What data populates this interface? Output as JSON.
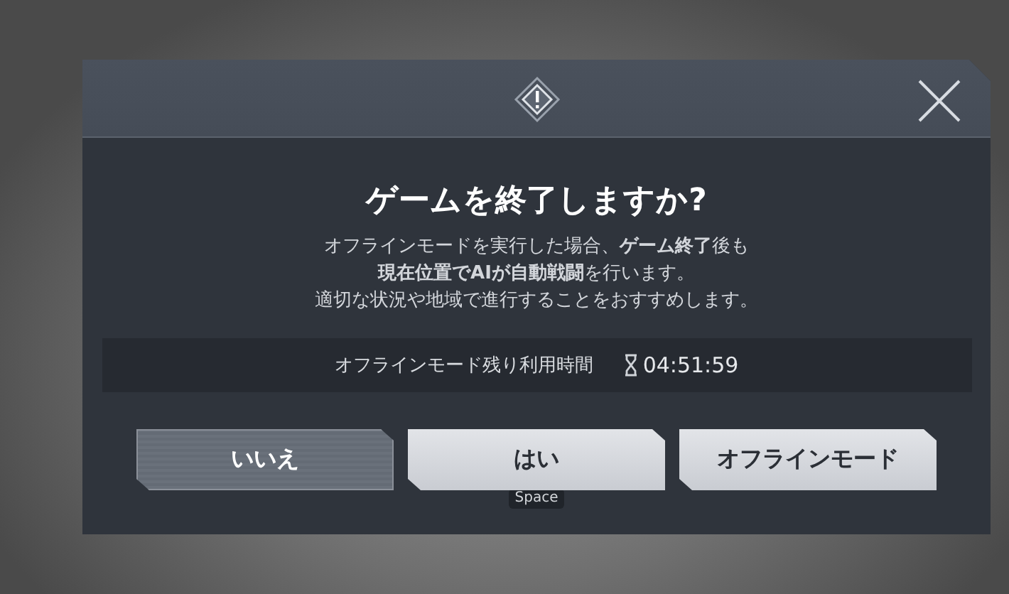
{
  "dialog": {
    "title": "ゲームを**終了**しますか?",
    "message": [
      "オフラインモードを実行した場合、**ゲーム終了**後も",
      "**現在位置でAIが自動戦闘**を行います。",
      "適切な状況や地域で進行することをおすすめします。"
    ],
    "timer": {
      "label": "オフラインモード残り利用時間",
      "value": "04:51:59"
    },
    "buttons": [
      {
        "label": "いいえ",
        "kind": "dark"
      },
      {
        "label": "はい",
        "kind": "light",
        "hint": "Space"
      },
      {
        "label": "オフラインモード",
        "kind": "light"
      }
    ]
  }
}
